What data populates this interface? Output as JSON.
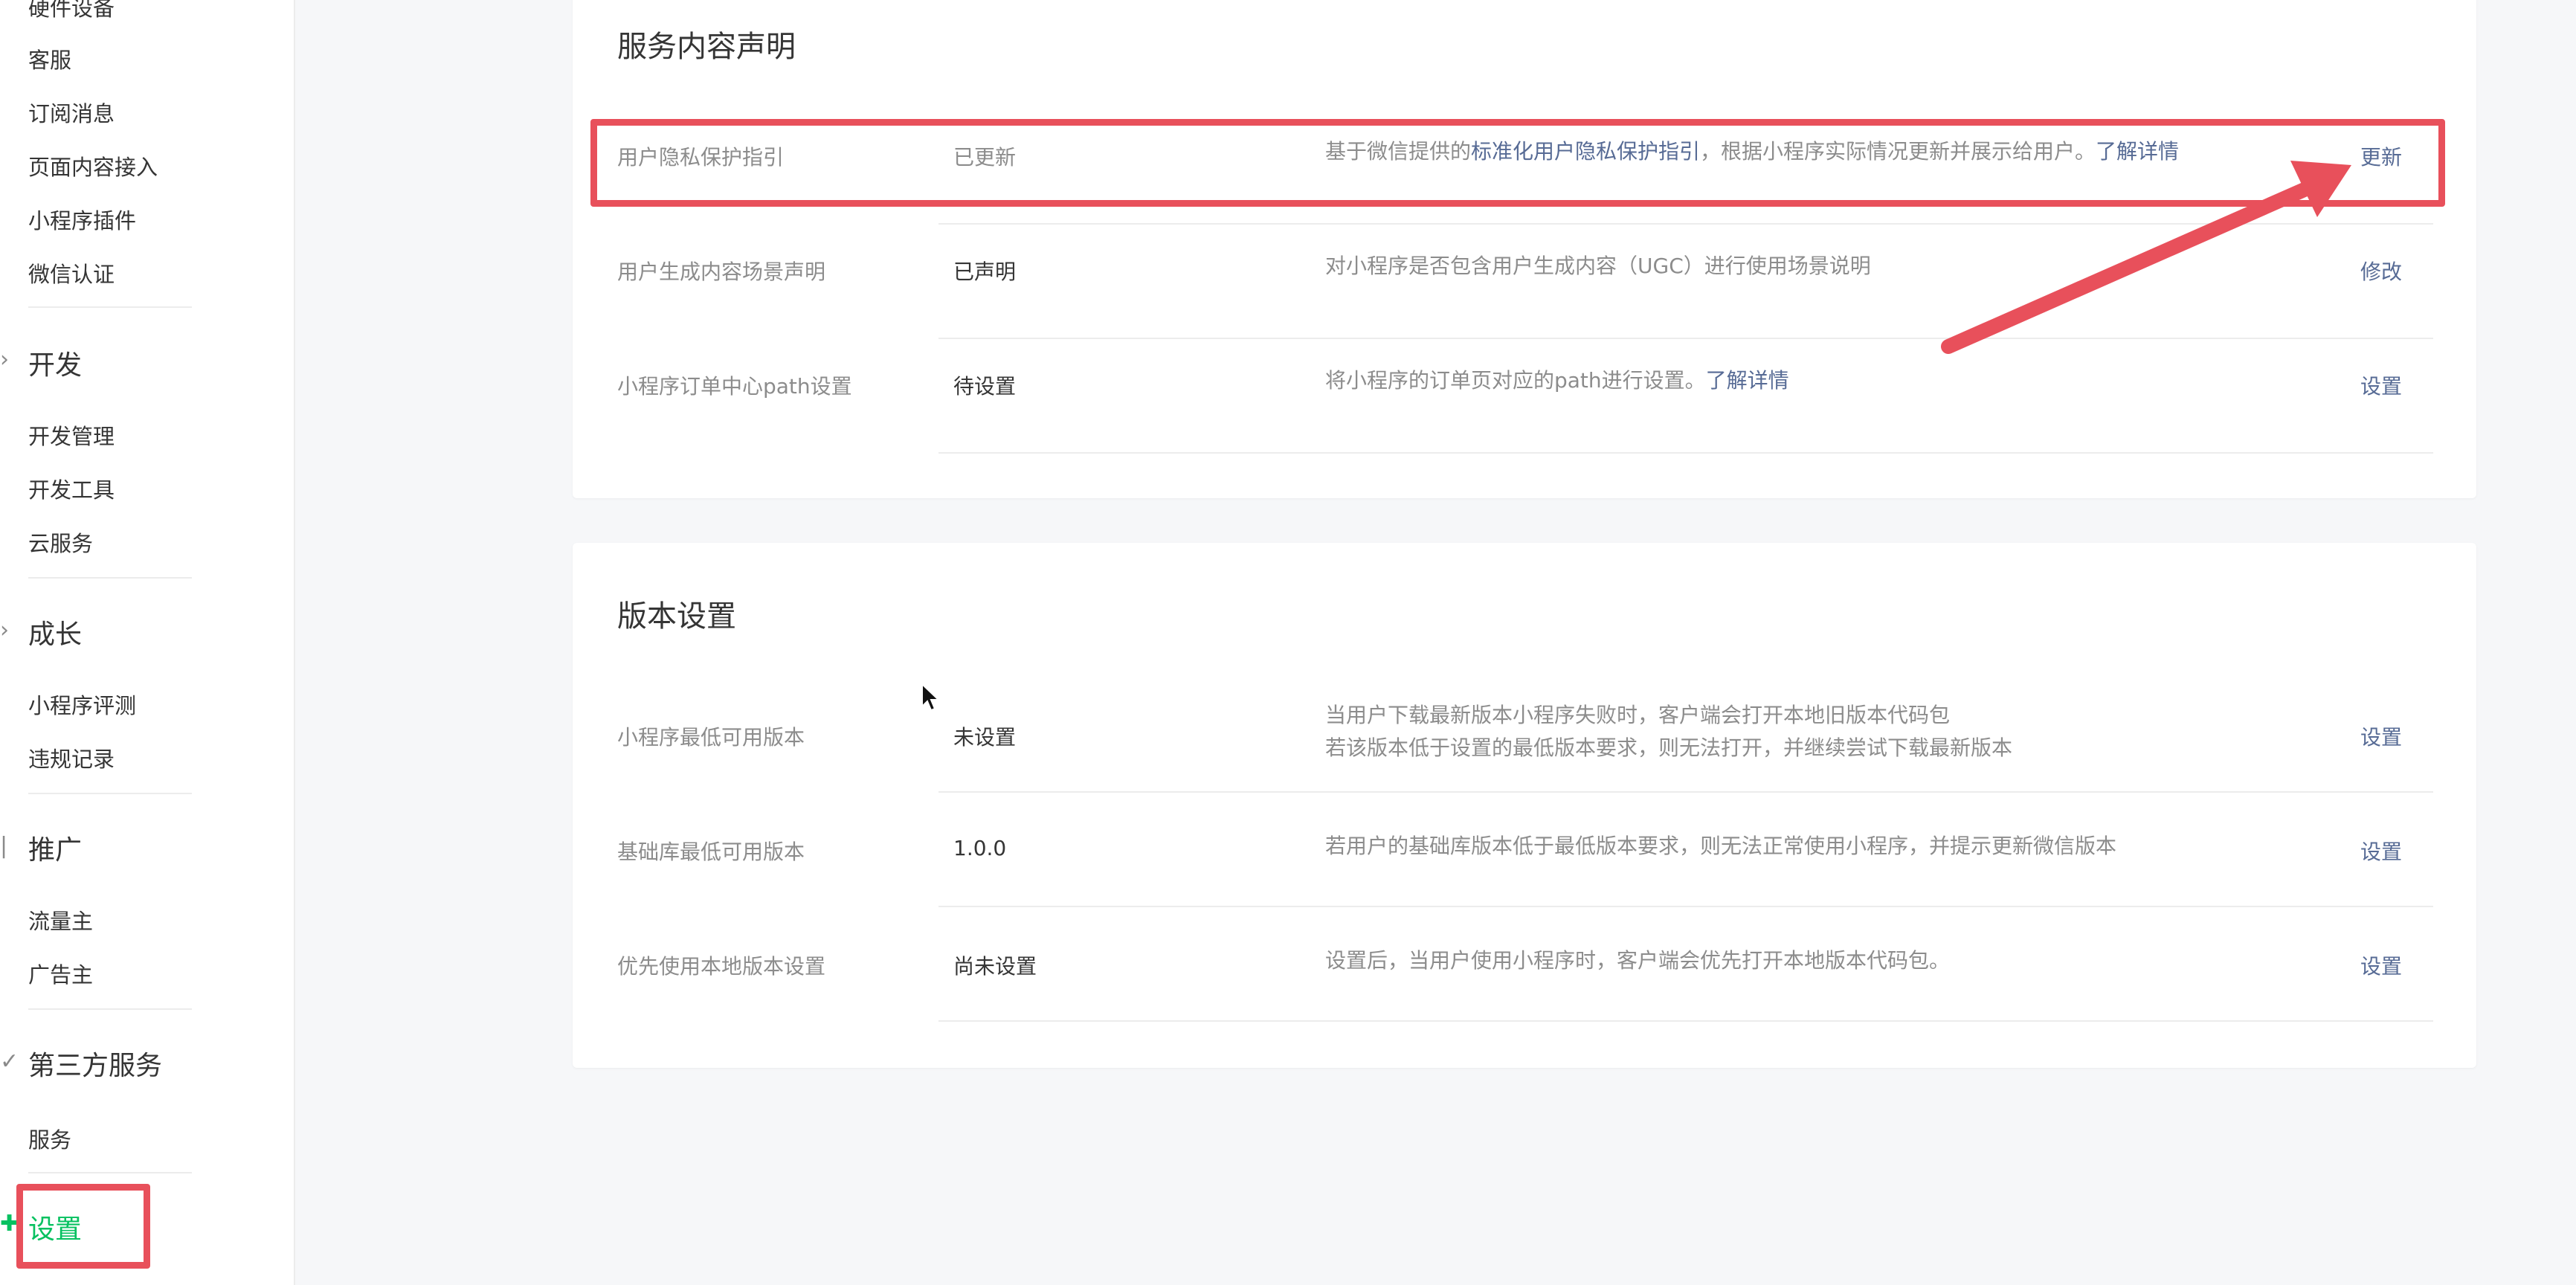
{
  "sidebar": {
    "items_top": [
      "硬件设备",
      "客服",
      "订阅消息",
      "页面内容接入",
      "小程序插件",
      "微信认证"
    ],
    "dev": {
      "title": "开发",
      "items": [
        "开发管理",
        "开发工具",
        "云服务"
      ]
    },
    "growth": {
      "title": "成长",
      "items": [
        "小程序评测",
        "违规记录"
      ]
    },
    "promo": {
      "title": "推广",
      "items": [
        "流量主",
        "广告主"
      ]
    },
    "third": {
      "title": "第三方服务",
      "items": [
        "服务"
      ]
    },
    "settings": {
      "title": "设置"
    }
  },
  "service_card": {
    "title": "服务内容声明",
    "rows": [
      {
        "label": "用户隐私保护指引",
        "status": "已更新",
        "desc_pre": "基于微信提供的",
        "desc_link": "标准化用户隐私保护指引",
        "desc_mid": "，根据小程序实际情况更新并展示给用户。",
        "desc_link2": "了解详情",
        "action": "更新"
      },
      {
        "label": "用户生成内容场景声明",
        "status": "已声明",
        "desc": "对小程序是否包含用户生成内容（UGC）进行使用场景说明",
        "action": "修改"
      },
      {
        "label": "小程序订单中心path设置",
        "status": "待设置",
        "desc_pre": "将小程序的订单页对应的path进行设置。",
        "desc_link": "了解详情",
        "action": "设置"
      }
    ]
  },
  "version_card": {
    "title": "版本设置",
    "rows": [
      {
        "label": "小程序最低可用版本",
        "status": "未设置",
        "desc_line1": "当用户下载最新版本小程序失败时，客户端会打开本地旧版本代码包",
        "desc_line2": "若该版本低于设置的最低版本要求，则无法打开，并继续尝试下载最新版本",
        "action": "设置"
      },
      {
        "label": "基础库最低可用版本",
        "status": "1.0.0",
        "desc": "若用户的基础库版本低于最低版本要求，则无法正常使用小程序，并提示更新微信版本",
        "action": "设置"
      },
      {
        "label": "优先使用本地版本设置",
        "status": "尚未设置",
        "desc": "设置后，当用户使用小程序时，客户端会优先打开本地版本代码包。",
        "action": "设置"
      }
    ]
  },
  "colors": {
    "accent_green": "#07c160",
    "link_blue": "#576b95",
    "annotation_red": "#e8505b"
  }
}
